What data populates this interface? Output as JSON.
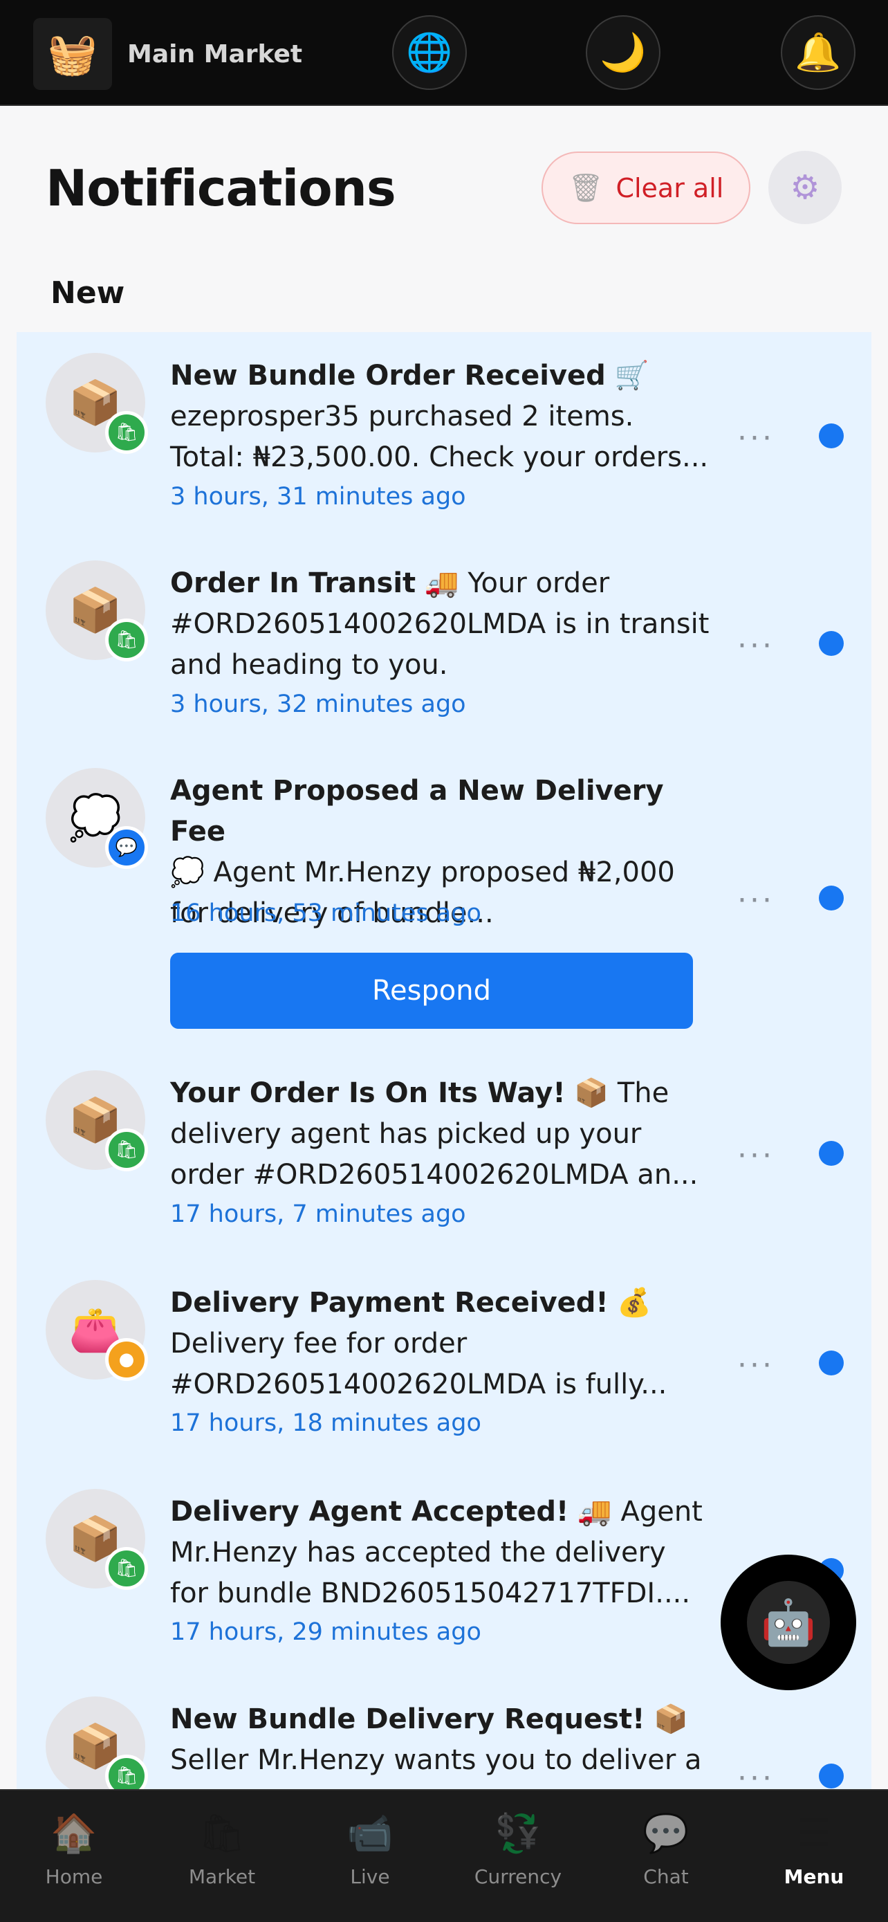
{
  "header": {
    "brand_name": "Main Market",
    "icons": [
      "globe-icon",
      "moon-icon",
      "bell-icon"
    ]
  },
  "page": {
    "title": "Notifications",
    "clear_all_label": "Clear all",
    "section_new": "New"
  },
  "notifications": [
    {
      "title": "New Bundle Order Received",
      "title_emoji": "🛒",
      "line1": "ezeprosper35 purchased 2 items.",
      "line2": "Total: ₦23,500.00. Check your orders...",
      "time": "3 hours, 31 minutes ago",
      "icon": "package-icon",
      "badge": "shopping-bag-badge"
    },
    {
      "title": "Order In Transit",
      "title_emoji": "🚚",
      "line1": "Your order",
      "line2": "#ORD260514002620LMDA is in transit",
      "line3": "and heading to you.",
      "time": "3 hours, 32 minutes ago",
      "icon": "package-icon",
      "badge": "shopping-bag-badge"
    },
    {
      "title": "Agent Proposed a New Delivery Fee",
      "title_emoji": "💭",
      "line1": "Agent Mr.Henzy proposed ₦2,000",
      "line2": "for delivery of bundle...",
      "time": "16 hours, 53 minutes ago",
      "icon": "thought-bubble-icon",
      "badge": "chat-badge",
      "action_label": "Respond"
    },
    {
      "title": "Your Order Is On Its Way!",
      "title_emoji": "📦",
      "line1": "The",
      "line2": "delivery agent has picked up your",
      "line3": "order #ORD260514002620LMDA an...",
      "time": "17 hours, 7 minutes ago",
      "icon": "package-icon",
      "badge": "shopping-bag-badge"
    },
    {
      "title": "Delivery Payment Received!",
      "title_emoji": "💰",
      "line1": "Delivery fee for order",
      "line2": "#ORD260514002620LMDA is fully...",
      "time": "17 hours, 18 minutes ago",
      "icon": "purse-icon",
      "badge": "coin-badge"
    },
    {
      "title": "Delivery Agent Accepted!",
      "title_emoji": "🚚",
      "line1": "Agent",
      "line2": "Mr.Henzy has accepted the delivery",
      "line3": "for bundle BND260515042717TFDI....",
      "time": "17 hours, 29 minutes ago",
      "icon": "package-icon",
      "badge": "shopping-bag-badge"
    },
    {
      "title": "New Bundle Delivery Request!",
      "title_emoji": "📦",
      "line1": "Seller Mr.Henzy wants you to deliver a",
      "icon": "package-icon",
      "badge": "shopping-bag-badge"
    }
  ],
  "bottom_nav": [
    {
      "label": "Home",
      "icon": "house-icon"
    },
    {
      "label": "Market",
      "icon": "shopping-bags-icon"
    },
    {
      "label": "Live",
      "icon": "video-camera-icon"
    },
    {
      "label": "Currency",
      "icon": "currency-exchange-icon"
    },
    {
      "label": "Chat",
      "icon": "speech-bubble-icon"
    },
    {
      "label": "Menu",
      "icon": "menu-icon",
      "active": true
    }
  ],
  "colors": {
    "accent": "#1877f2",
    "time_text": "#1d72d8",
    "clear_all_text": "#d01f26",
    "list_background": "#e7f3ff"
  }
}
